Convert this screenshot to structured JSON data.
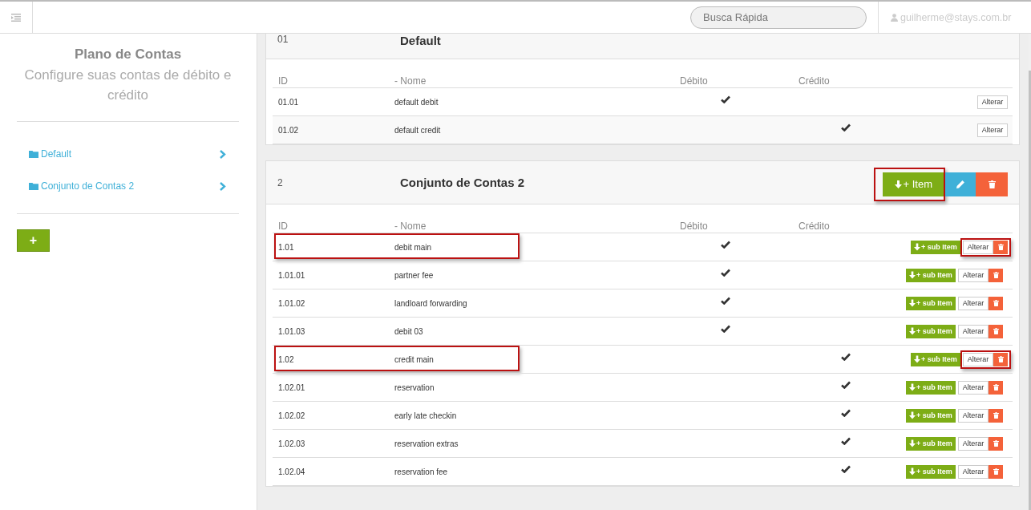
{
  "topbar": {
    "search": {
      "placeholder": "Busca Rápida"
    },
    "user": "guilherme@stays.com.br"
  },
  "sidebar": {
    "title": "Plano de Contas",
    "subtitle": "Configure suas contas de débito e crédito",
    "items": [
      {
        "label": "Default"
      },
      {
        "label": "Conjunto de Contas 2"
      }
    ],
    "add_button": "+"
  },
  "sections": [
    {
      "kind": "basic",
      "id": "01",
      "title": "Default",
      "columns": [
        "ID",
        "- Nome",
        "Débito",
        "Crédito"
      ],
      "rows": [
        {
          "id": "01.01",
          "name": "default debit",
          "debit": true,
          "credit": false,
          "edit": "Alterar",
          "highlighted": false,
          "actions_highlighted": false
        },
        {
          "id": "01.02",
          "name": "default credit",
          "debit": false,
          "credit": true,
          "edit": "Alterar",
          "highlighted": false,
          "actions_highlighted": false
        }
      ]
    },
    {
      "kind": "editable",
      "id": "2",
      "title": "Conjunto de Contas 2",
      "item_button": {
        "label": "+ Item",
        "highlighted": true
      },
      "columns": [
        "ID",
        "- Nome",
        "Débito",
        "Crédito"
      ],
      "rows": [
        {
          "id": "1.01",
          "name": "debit main",
          "debit": true,
          "credit": false,
          "sub_item": "+ sub Item",
          "edit": "Alterar",
          "highlighted": true,
          "actions_highlighted": true
        },
        {
          "id": "1.01.01",
          "name": "partner fee",
          "debit": true,
          "credit": false,
          "sub_item": "+ sub Item",
          "edit": "Alterar",
          "highlighted": false,
          "actions_highlighted": false
        },
        {
          "id": "1.01.02",
          "name": "landloard forwarding",
          "debit": true,
          "credit": false,
          "sub_item": "+ sub Item",
          "edit": "Alterar",
          "highlighted": false,
          "actions_highlighted": false
        },
        {
          "id": "1.01.03",
          "name": "debit 03",
          "debit": true,
          "credit": false,
          "sub_item": "+ sub Item",
          "edit": "Alterar",
          "highlighted": false,
          "actions_highlighted": false
        },
        {
          "id": "1.02",
          "name": "credit main",
          "debit": false,
          "credit": true,
          "sub_item": "+ sub Item",
          "edit": "Alterar",
          "highlighted": true,
          "actions_highlighted": true
        },
        {
          "id": "1.02.01",
          "name": "reservation",
          "debit": false,
          "credit": true,
          "sub_item": "+ sub Item",
          "edit": "Alterar",
          "highlighted": false,
          "actions_highlighted": false
        },
        {
          "id": "1.02.02",
          "name": "early late checkin",
          "debit": false,
          "credit": true,
          "sub_item": "+ sub Item",
          "edit": "Alterar",
          "highlighted": false,
          "actions_highlighted": false
        },
        {
          "id": "1.02.03",
          "name": "reservation extras",
          "debit": false,
          "credit": true,
          "sub_item": "+ sub Item",
          "edit": "Alterar",
          "highlighted": false,
          "actions_highlighted": false
        },
        {
          "id": "1.02.04",
          "name": "reservation fee",
          "debit": false,
          "credit": true,
          "sub_item": "+ sub Item",
          "edit": "Alterar",
          "highlighted": false,
          "actions_highlighted": false
        }
      ]
    }
  ]
}
